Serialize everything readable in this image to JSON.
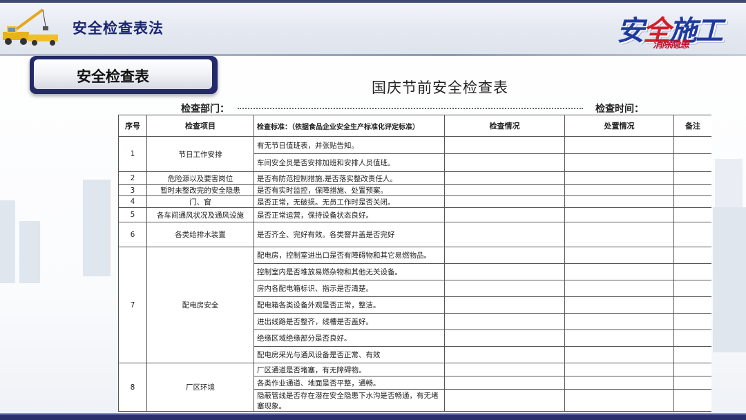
{
  "header": {
    "title": "安全检查表法"
  },
  "logo": {
    "main_a": "安",
    "main_b": "全",
    "main_c": "施工",
    "sub": "消除隐患"
  },
  "section_tab": {
    "label": "安全检查表"
  },
  "document": {
    "title": "国庆节前安全检查表",
    "dept_label": "检查部门：",
    "time_label": "检查时间：",
    "columns": [
      "序号",
      "检查项目",
      "检查标准：（依据食品企业安全生产标准化评定标准）",
      "检查情况",
      "处置情况",
      "备注"
    ],
    "rows": [
      {
        "no": "1",
        "item": "节日工作安排",
        "standards": [
          "有无节日值班表，并张贴告知。",
          "车间安全员是否安排加班和安排人员值班。"
        ]
      },
      {
        "no": "2",
        "item": "危险源以及要害岗位",
        "standards": [
          "是否有防范控制措施,是否落实整改责任人。"
        ]
      },
      {
        "no": "3",
        "item": "暂时未整改完的安全隐患",
        "standards": [
          "是否有实时监控，保障措施、处置预案。"
        ]
      },
      {
        "no": "4",
        "item": "门、窗",
        "standards": [
          "是否正常，无破损。无员工作时是否关闭。"
        ]
      },
      {
        "no": "5",
        "item": "各车间通风状况及通风设施",
        "standards": [
          "是否正常运营，保持设备状态良好。"
        ]
      },
      {
        "no": "6",
        "item": "各类给排水装置",
        "standards": [
          "是否齐全、完好有效。各类窨井盖是否完好"
        ]
      },
      {
        "no": "7",
        "item": "配电房安全",
        "standards": [
          "配电房，控制室进出口是否有障碍物和其它易燃物品。",
          "控制室内是否堆放易燃杂物和其他无关设备。",
          "房内各配电箱标识、指示是否清楚。",
          "配电箱各类设备外观是否正常，整洁。",
          "进出线路是否整齐，线槽是否盖好。",
          "绝缘区域绝缘部分是否良好。",
          "配电房采光与通风设备是否正常、有效"
        ]
      },
      {
        "no": "8",
        "item": "厂区环境",
        "standards": [
          "厂区通道是否堵塞，有无障碍物。",
          "各类作业通道、地面是否平整，通畅。",
          "隐蔽管线是否存在潜在安全隐患下水沟是否畅通，有无堵塞现象。"
        ]
      }
    ]
  }
}
